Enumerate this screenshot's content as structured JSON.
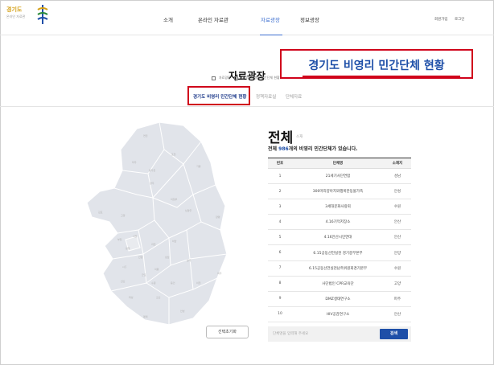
{
  "header": {
    "logo_title": "경기도",
    "logo_subtitle": "온라인 자료관",
    "nav": [
      {
        "label": "소개"
      },
      {
        "label": "온라인 자료관"
      },
      {
        "label": "자료광장"
      },
      {
        "label": "정보광장"
      }
    ],
    "util": [
      {
        "label": "회원가입"
      },
      {
        "label": "로그인"
      }
    ]
  },
  "page": {
    "title": "자료광장",
    "breadcrumb": [
      "자료광장",
      "경기도 비영리 민간단체 현황"
    ],
    "callout": "경기도 비영리 민간단체 현황"
  },
  "tabs": [
    {
      "label": "경기도 비영리 민간단체 현황",
      "active": true
    },
    {
      "label": "정책자료실",
      "active": false
    },
    {
      "label": "단체자료",
      "active": false
    }
  ],
  "map": {
    "regions": [
      "연천",
      "포천",
      "가평",
      "파주",
      "동두천",
      "양주",
      "김포",
      "고양",
      "의정부",
      "남양주",
      "양평",
      "부천",
      "서울",
      "하남",
      "광명",
      "시흥",
      "안양",
      "과천",
      "성남",
      "광주",
      "안산",
      "군포",
      "의왕",
      "용인",
      "이천",
      "여주",
      "수원",
      "화성",
      "오산",
      "평택",
      "안성"
    ],
    "reset_label": "선택초기화"
  },
  "list": {
    "heading": "전체",
    "heading_suffix": "소재",
    "count_prefix": "전체",
    "count_value": "986",
    "count_suffix": "개의 비영리 민간단체가 있습니다.",
    "columns": [
      "번호",
      "단체명",
      "소재지"
    ],
    "rows": [
      {
        "no": "1",
        "name": "21세기사단연합",
        "loc": "성남"
      },
      {
        "no": "2",
        "name": "300마리양아지와행복한동물가족",
        "loc": "안성"
      },
      {
        "no": "3",
        "name": "3세대문화사랑회",
        "loc": "수원"
      },
      {
        "no": "4",
        "name": "4.16기억저장소",
        "loc": "안산"
      },
      {
        "no": "5",
        "name": "4.16안산시민연대",
        "loc": "안산"
      },
      {
        "no": "6",
        "name": "6.15공동선언실천 경기중부본부",
        "loc": "안양"
      },
      {
        "no": "7",
        "name": "6.15공동선언실천남측위원회경기본부",
        "loc": "수원"
      },
      {
        "no": "8",
        "name": "사단법인 CPR교육단",
        "loc": "고양"
      },
      {
        "no": "9",
        "name": "DMZ생태연구소",
        "loc": "파주"
      },
      {
        "no": "10",
        "name": "HIV공감연구소",
        "loc": "안산"
      }
    ],
    "search_placeholder": "단체명을 입력해 주세요",
    "search_button": "검색"
  }
}
